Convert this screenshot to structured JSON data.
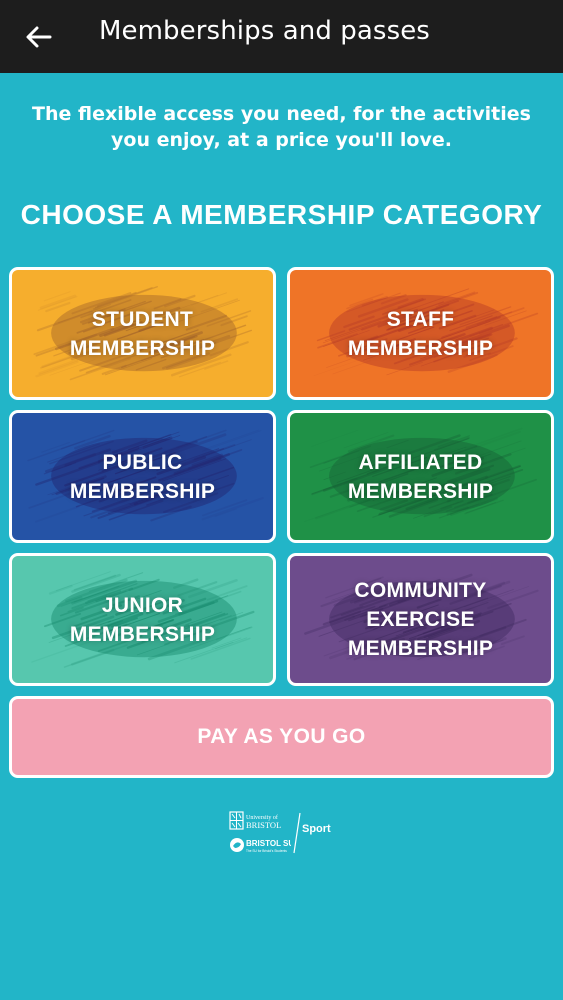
{
  "appbar": {
    "title": "Memberships and passes",
    "back_icon": "arrow-left-icon"
  },
  "tagline": "The flexible access you need, for the activities you enjoy, at a price you'll love.",
  "heading": "CHOOSE A MEMBERSHIP CATEGORY",
  "categories": [
    {
      "label": "STUDENT\nMEMBERSHIP",
      "color": "#f6ae2d",
      "brush": "#a2632a"
    },
    {
      "label": "STAFF\nMEMBERSHIP",
      "color": "#ef7427",
      "brush": "#b53a26"
    },
    {
      "label": "PUBLIC\nMEMBERSHIP",
      "color": "#2553a6",
      "brush": "#22246e"
    },
    {
      "label": "AFFILIATED\nMEMBERSHIP",
      "color": "#1f9147",
      "brush": "#166236"
    },
    {
      "label": "JUNIOR\nMEMBERSHIP",
      "color": "#57c7ae",
      "brush": "#168a6c"
    },
    {
      "label": "COMMUNITY\nEXERCISE\nMEMBERSHIP",
      "color": "#6d4c8c",
      "brush": "#3f2a5f"
    }
  ],
  "pay_as_you_go": {
    "label": "PAY AS YOU GO",
    "color": "#f3a2b3"
  },
  "footer": {
    "uob_line1": "University of",
    "uob_line2": "BRISTOL",
    "bsu_name": "BRISTOL SU",
    "bsu_tagline": "The SU for Bristol's Students",
    "sport_label": "Sport"
  },
  "colors": {
    "background": "#22b5c8",
    "appbar": "#1d1d1d",
    "text": "#ffffff"
  }
}
